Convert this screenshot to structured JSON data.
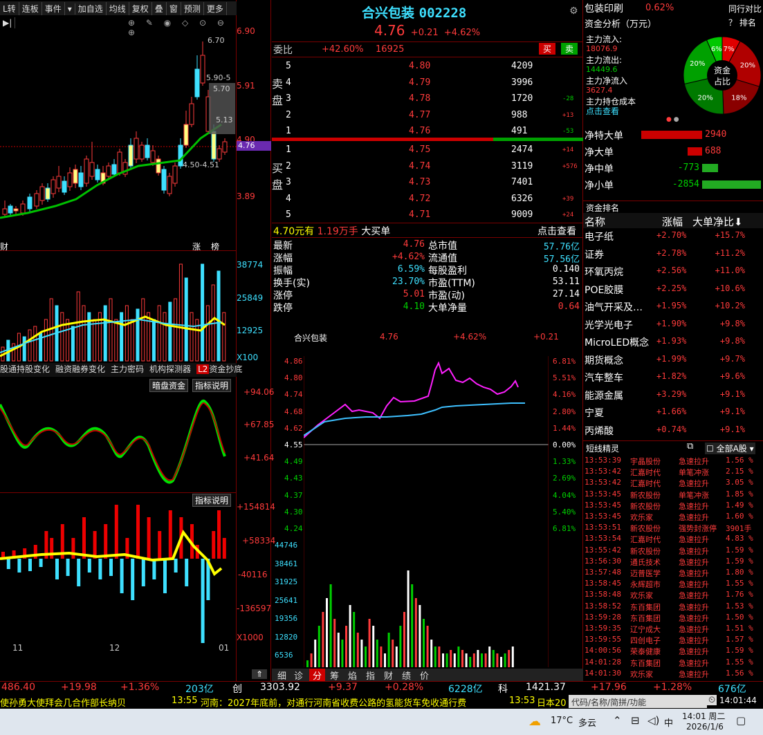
{
  "toolbar": [
    "L转",
    "连板",
    "事件",
    "加自选",
    "均线",
    "复权",
    "叠",
    "窗",
    "预测",
    "更多"
  ],
  "kline": {
    "prices": [
      "6.90",
      "5.91",
      "4.90",
      "3.89"
    ],
    "labels": {
      "hi": "6.70",
      "p1": "5.90-5",
      "p2": "5.70",
      "p3": "5.13",
      "lo": "4.50-4.51",
      "cur": "4.76"
    },
    "foot": [
      "财",
      "涨",
      "榜"
    ]
  },
  "vol": {
    "scale": [
      "38774",
      "25849",
      "12925"
    ],
    "unit": "X100"
  },
  "ind_tabs": [
    "股通持股变化",
    "融资融券变化",
    "主力密码",
    "机构探测器",
    "资金抄底"
  ],
  "ind_l2": "L2",
  "ind1": {
    "btn1": "暗盘资金",
    "btn2": "指标说明",
    "scale": [
      "+94.06",
      "+67.85",
      "+41.64"
    ]
  },
  "ind2": {
    "btn": "指标说明",
    "scale": [
      "+154814",
      "+58334",
      "-40116",
      "-136597"
    ],
    "unit": "X1000"
  },
  "dates": [
    "11",
    "12",
    "01"
  ],
  "stock": {
    "name": "合兴包装",
    "code": "002228",
    "price": "4.76",
    "chg": "+0.21",
    "pct": "+4.62%"
  },
  "wei": {
    "label": "委比",
    "ratio": "+42.60%",
    "diff": "16925",
    "buy": "买",
    "sell": "卖"
  },
  "sell_label": "卖盘",
  "buy_label": "买盘",
  "asks": [
    {
      "n": "5",
      "p": "4.80",
      "v": "4209",
      "d": ""
    },
    {
      "n": "4",
      "p": "4.79",
      "v": "3996",
      "d": ""
    },
    {
      "n": "3",
      "p": "4.78",
      "v": "1720",
      "d": "-28"
    },
    {
      "n": "2",
      "p": "4.77",
      "v": "988",
      "d": "+13"
    },
    {
      "n": "1",
      "p": "4.76",
      "v": "491",
      "d": "-53"
    }
  ],
  "bids": [
    {
      "n": "1",
      "p": "4.75",
      "v": "2474",
      "d": "+14"
    },
    {
      "n": "2",
      "p": "4.74",
      "v": "3119",
      "d": "+576"
    },
    {
      "n": "3",
      "p": "4.73",
      "v": "7401",
      "d": ""
    },
    {
      "n": "4",
      "p": "4.72",
      "v": "6326",
      "d": "+39"
    },
    {
      "n": "5",
      "p": "4.71",
      "v": "9009",
      "d": "+24"
    }
  ],
  "bigorder": {
    "price": "4.70元有",
    "amt": "1.19万手",
    "txt": "大买单",
    "link": "点击查看"
  },
  "stats": [
    {
      "k": "最新",
      "v": "4.76",
      "k2": "总市值",
      "v2": "57.76亿"
    },
    {
      "k": "涨幅",
      "v": "+4.62%",
      "k2": "流通值",
      "v2": "57.56亿"
    },
    {
      "k": "振幅",
      "v": "6.59%",
      "k2": "每股盈利",
      "v2": "0.140"
    },
    {
      "k": "换手(实)",
      "v": "23.70%",
      "k2": "市盈(TTM)",
      "v2": "53.11"
    },
    {
      "k": "涨停",
      "v": "5.01",
      "k2": "市盈(动)",
      "v2": "27.14"
    },
    {
      "k": "跌停",
      "v": "4.10",
      "k2": "大单净量",
      "v2": "0.64"
    }
  ],
  "intraday": {
    "name": "合兴包装",
    "price": "4.76",
    "pct": "+4.62%",
    "chg": "+0.21",
    "left": [
      "4.86",
      "4.80",
      "4.74",
      "4.68",
      "4.62",
      "4.55",
      "4.49",
      "4.43",
      "4.37",
      "4.30",
      "4.24"
    ],
    "right": [
      "6.81%",
      "5.51%",
      "4.16%",
      "2.80%",
      "1.44%",
      "0.00%",
      "1.33%",
      "2.69%",
      "4.04%",
      "5.40%",
      "6.81%"
    ],
    "vol": [
      "44746",
      "38461",
      "31925",
      "25641",
      "19356",
      "12820",
      "6536"
    ]
  },
  "mid_tabs": [
    "细",
    "诊",
    "分",
    "筹",
    "焰",
    "指",
    "财",
    "绩",
    "价"
  ],
  "flow": {
    "name": "包装印刷",
    "pct": "0.62%",
    "compare": "同行对比",
    "title": "资金分析（万元）",
    "rank": "？ 排名",
    "in_l": "主力流入:",
    "in_v": "18076.9",
    "out_l": "主力流出:",
    "out_v": "14449.6",
    "net_l": "主力净流入",
    "net_v": "3627.4",
    "cost_l": "主力持仓成本",
    "cost_link": "点击查看",
    "pie": [
      "7%",
      "20%",
      "18%",
      "20%",
      "20%",
      "6%"
    ],
    "center": "资金占比"
  },
  "netbars": [
    {
      "k": "净特大单",
      "v": "2940"
    },
    {
      "k": "净大单",
      "v": "688"
    },
    {
      "k": "净中单",
      "v": "-773"
    },
    {
      "k": "净小单",
      "v": "-2854"
    }
  ],
  "rank": {
    "title": "资金排名",
    "h": [
      "名称",
      "涨幅",
      "大单净比"
    ],
    "rows": [
      [
        "电子纸",
        "+2.70%",
        "+15.7%"
      ],
      [
        "证券",
        "+2.78%",
        "+11.2%"
      ],
      [
        "环氧丙烷",
        "+2.56%",
        "+11.0%"
      ],
      [
        "POE胶膜",
        "+2.25%",
        "+10.6%"
      ],
      [
        "油气开采及…",
        "+1.95%",
        "+10.2%"
      ],
      [
        "光学光电子",
        "+1.90%",
        "+9.8%"
      ],
      [
        "MicroLED概念",
        "+1.93%",
        "+9.8%"
      ],
      [
        "期货概念",
        "+1.99%",
        "+9.7%"
      ],
      [
        "汽车整车",
        "+1.82%",
        "+9.6%"
      ],
      [
        "能源金属",
        "+3.29%",
        "+9.1%"
      ],
      [
        "宁夏",
        "+1.66%",
        "+9.1%"
      ],
      [
        "丙烯酸",
        "+0.74%",
        "+9.1%"
      ]
    ]
  },
  "short": {
    "title": "短线精灵",
    "sel": "全部A股",
    "rows": [
      [
        "13:53:39",
        "宇晶股份",
        "急速拉升",
        "1.56 %"
      ],
      [
        "13:53:42",
        "汇嘉时代",
        "单笔冲涨",
        "2.15 %"
      ],
      [
        "13:53:42",
        "汇嘉时代",
        "急速拉升",
        "3.05 %"
      ],
      [
        "13:53:45",
        "新农股份",
        "单笔冲涨",
        "1.85 %"
      ],
      [
        "13:53:45",
        "新农股份",
        "急速拉升",
        "1.49 %"
      ],
      [
        "13:53:45",
        "欢乐家",
        "急速拉升",
        "1.60 %"
      ],
      [
        "13:53:51",
        "新农股份",
        "强势封涨停",
        "3901手"
      ],
      [
        "13:53:54",
        "汇嘉时代",
        "急速拉升",
        "4.83 %"
      ],
      [
        "13:55:42",
        "新农股份",
        "急速拉升",
        "1.59 %"
      ],
      [
        "13:56:30",
        "通氏技术",
        "急速拉升",
        "1.59 %"
      ],
      [
        "13:57:48",
        "迈普医学",
        "急速拉升",
        "1.80 %"
      ],
      [
        "13:58:45",
        "永辉超市",
        "急速拉升",
        "1.55 %"
      ],
      [
        "13:58:48",
        "欢乐家",
        "急速拉升",
        "1.76 %"
      ],
      [
        "13:58:52",
        "东百集团",
        "急速拉升",
        "1.53 %"
      ],
      [
        "13:59:28",
        "东百集团",
        "急速拉升",
        "1.50 %"
      ],
      [
        "13:59:35",
        "辽宁成大",
        "急速拉升",
        "1.51 %"
      ],
      [
        "13:59:55",
        "四创电子",
        "急速拉升",
        "1.57 %"
      ],
      [
        "14:00:56",
        "荣泰健康",
        "急速拉升",
        "1.59 %"
      ],
      [
        "14:01:28",
        "东百集团",
        "急速拉升",
        "1.55 %"
      ],
      [
        "14:01:30",
        "欢乐家",
        "急速拉升",
        "1.56 %"
      ]
    ]
  },
  "index": {
    "a": "486.40",
    "b": "+19.98",
    "c": "+1.36%",
    "d": "203亿",
    "e": "创",
    "f": "3303.92",
    "g": "+9.37",
    "h": "+0.28%",
    "i": "6228亿",
    "j": "科",
    "k": "1421.37",
    "l": "+17.96",
    "m": "+1.28%",
    "n": "676亿"
  },
  "ticker": {
    "a": "使孙勇大使拜会几合作部长纳贝",
    "t1": "13:55",
    "b": "河南：2027年底前，对通行河南省收费公路的氢能货车免收通行费",
    "t2": "13:53",
    "c": "日本20",
    "search": "代码/名称/简拼/功能",
    "clock": "14:01:44"
  },
  "taskbar": {
    "weather": "17°C",
    "cond": "多云",
    "time": "14:01 周二",
    "date": "2026/1/6",
    "ime": "中"
  }
}
